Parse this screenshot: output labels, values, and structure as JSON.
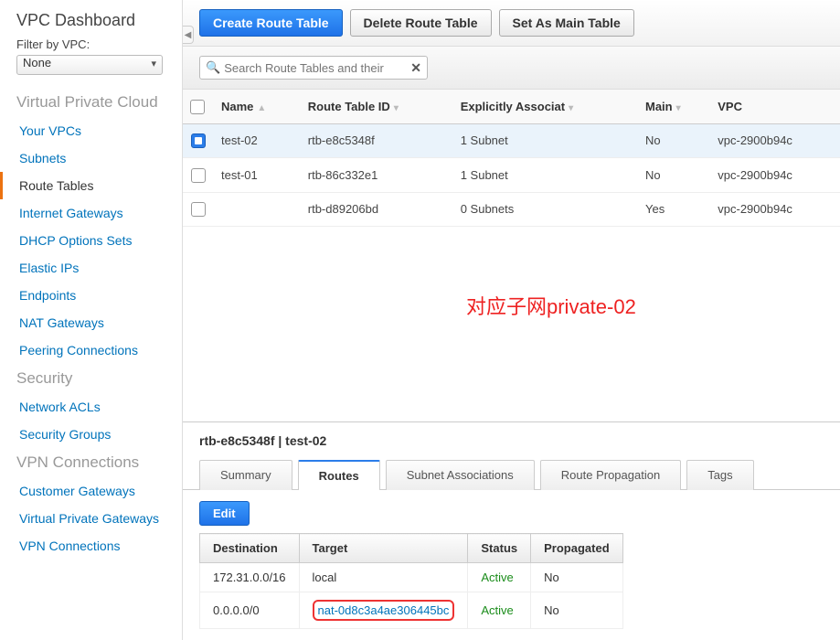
{
  "sidebar": {
    "title": "VPC Dashboard",
    "filter_label": "Filter by VPC:",
    "filter_value": "None",
    "groups": [
      {
        "header": "Virtual Private Cloud",
        "items": [
          {
            "label": "Your VPCs",
            "active": false
          },
          {
            "label": "Subnets",
            "active": false
          },
          {
            "label": "Route Tables",
            "active": true
          },
          {
            "label": "Internet Gateways",
            "active": false
          },
          {
            "label": "DHCP Options Sets",
            "active": false
          },
          {
            "label": "Elastic IPs",
            "active": false
          },
          {
            "label": "Endpoints",
            "active": false
          },
          {
            "label": "NAT Gateways",
            "active": false
          },
          {
            "label": "Peering Connections",
            "active": false
          }
        ]
      },
      {
        "header": "Security",
        "items": [
          {
            "label": "Network ACLs",
            "active": false
          },
          {
            "label": "Security Groups",
            "active": false
          }
        ]
      },
      {
        "header": "VPN Connections",
        "items": [
          {
            "label": "Customer Gateways",
            "active": false
          },
          {
            "label": "Virtual Private Gateways",
            "active": false
          },
          {
            "label": "VPN Connections",
            "active": false
          }
        ]
      }
    ]
  },
  "toolbar": {
    "create_label": "Create Route Table",
    "delete_label": "Delete Route Table",
    "setmain_label": "Set As Main Table"
  },
  "search": {
    "placeholder": "Search Route Tables and their"
  },
  "grid": {
    "headers": {
      "name": "Name",
      "rtid": "Route Table ID",
      "assoc": "Explicitly Associat",
      "main": "Main",
      "vpc": "VPC"
    },
    "rows": [
      {
        "selected": true,
        "name": "test-02",
        "rtid": "rtb-e8c5348f",
        "assoc": "1 Subnet",
        "main": "No",
        "vpc": "vpc-2900b94c"
      },
      {
        "selected": false,
        "name": "test-01",
        "rtid": "rtb-86c332e1",
        "assoc": "1 Subnet",
        "main": "No",
        "vpc": "vpc-2900b94c"
      },
      {
        "selected": false,
        "name": "",
        "rtid": "rtb-d89206bd",
        "assoc": "0 Subnets",
        "main": "Yes",
        "vpc": "vpc-2900b94c"
      }
    ]
  },
  "annotation": "对应子网private-02",
  "detail": {
    "title": "rtb-e8c5348f | test-02",
    "tabs": [
      {
        "label": "Summary",
        "active": false
      },
      {
        "label": "Routes",
        "active": true
      },
      {
        "label": "Subnet Associations",
        "active": false
      },
      {
        "label": "Route Propagation",
        "active": false
      },
      {
        "label": "Tags",
        "active": false
      }
    ],
    "edit_label": "Edit",
    "route_headers": {
      "dest": "Destination",
      "target": "Target",
      "status": "Status",
      "prop": "Propagated"
    },
    "routes": [
      {
        "dest": "172.31.0.0/16",
        "target": "local",
        "target_link": false,
        "status": "Active",
        "prop": "No",
        "highlight": false
      },
      {
        "dest": "0.0.0.0/0",
        "target": "nat-0d8c3a4ae306445bc",
        "target_link": true,
        "status": "Active",
        "prop": "No",
        "highlight": true
      }
    ]
  }
}
